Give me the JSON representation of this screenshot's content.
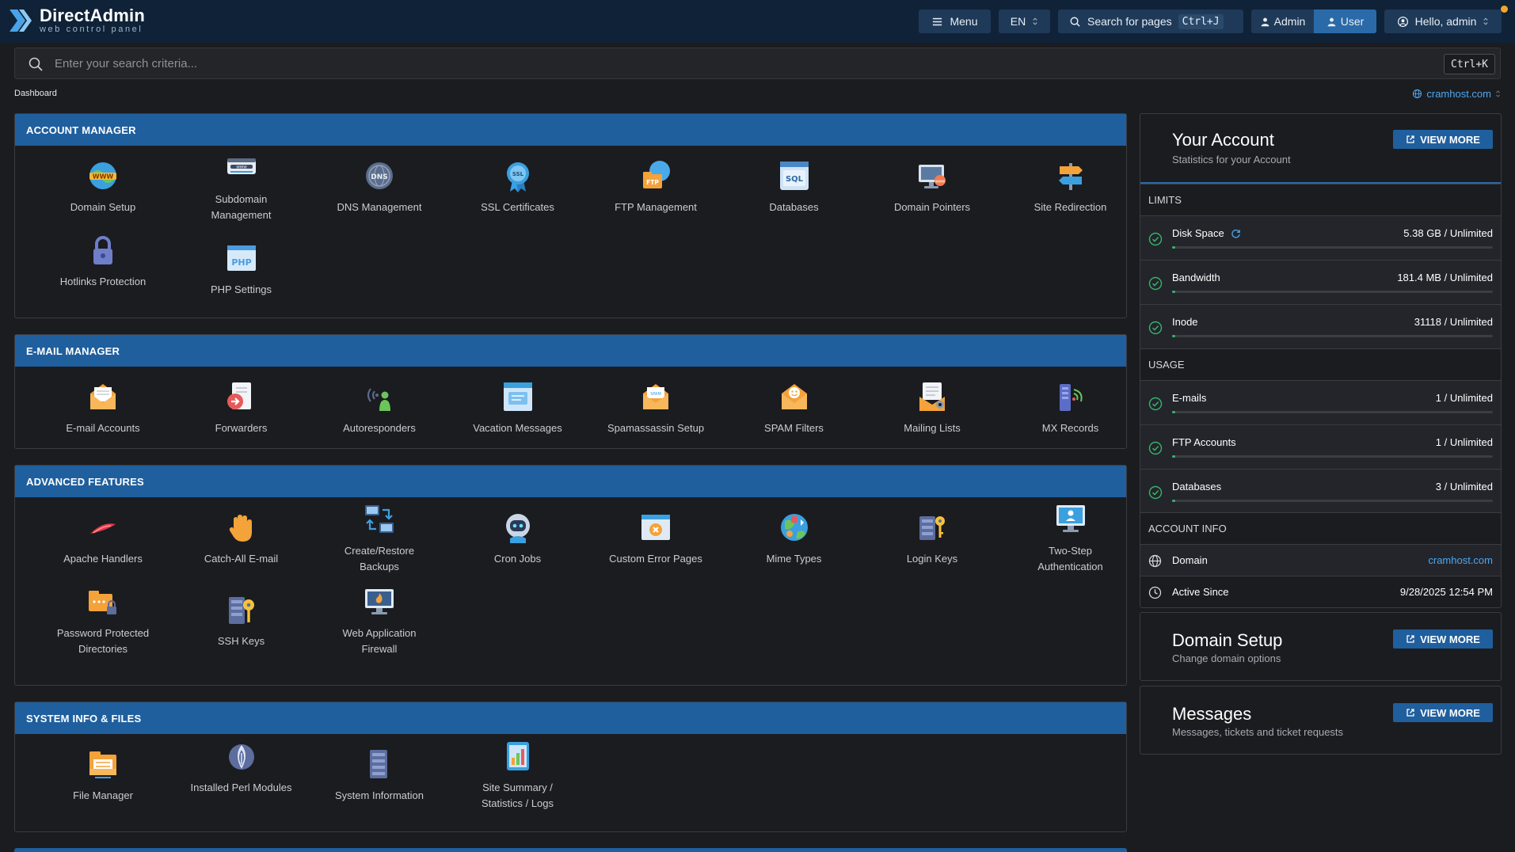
{
  "app": {
    "brand": "DirectAdmin",
    "brand_sub": "web control panel"
  },
  "topbar": {
    "menu_label": "Menu",
    "lang_label": "EN",
    "search_pages_label": "Search for pages",
    "search_pages_shortcut": "Ctrl+J",
    "role_admin": "Admin",
    "role_user": "User",
    "greeting": "Hello, admin"
  },
  "search": {
    "placeholder": "Enter your search criteria...",
    "shortcut": "Ctrl+K"
  },
  "breadcrumb": "Dashboard",
  "current_domain": "cramhost.com",
  "sections": {
    "account": {
      "title": "ACCOUNT MANAGER",
      "items": [
        {
          "label": "Domain Setup",
          "icon": "globe-www-icon"
        },
        {
          "label": "Subdomain Management",
          "icon": "subdomain-browser-icon"
        },
        {
          "label": "DNS Management",
          "icon": "dns-globe-icon"
        },
        {
          "label": "SSL Certificates",
          "icon": "ssl-badge-icon"
        },
        {
          "label": "FTP Management",
          "icon": "ftp-folder-icon"
        },
        {
          "label": "Databases",
          "icon": "sql-database-icon"
        },
        {
          "label": "Domain Pointers",
          "icon": "monitor-www-icon"
        },
        {
          "label": "Site Redirection",
          "icon": "signpost-icon"
        },
        {
          "label": "Hotlinks Protection",
          "icon": "padlock-icon"
        },
        {
          "label": "PHP Settings",
          "icon": "php-window-icon"
        }
      ]
    },
    "email": {
      "title": "E-MAIL MANAGER",
      "items": [
        {
          "label": "E-mail Accounts",
          "icon": "envelope-open-icon"
        },
        {
          "label": "Forwarders",
          "icon": "forward-document-icon"
        },
        {
          "label": "Autoresponders",
          "icon": "broadcast-person-icon"
        },
        {
          "label": "Vacation Messages",
          "icon": "calendar-message-icon"
        },
        {
          "label": "Spamassassin Setup",
          "icon": "envelope-spam-icon"
        },
        {
          "label": "SPAM Filters",
          "icon": "envelope-filter-icon"
        },
        {
          "label": "Mailing Lists",
          "icon": "envelope-list-icon"
        },
        {
          "label": "MX Records",
          "icon": "server-signal-icon"
        }
      ]
    },
    "advanced": {
      "title": "ADVANCED FEATURES",
      "items": [
        {
          "label": "Apache Handlers",
          "icon": "apache-feather-icon"
        },
        {
          "label": "Catch-All E-mail",
          "icon": "catching-hand-icon"
        },
        {
          "label": "Create/Restore Backups",
          "icon": "backup-computers-icon"
        },
        {
          "label": "Cron Jobs",
          "icon": "robot-icon"
        },
        {
          "label": "Custom Error Pages",
          "icon": "error-page-icon"
        },
        {
          "label": "Mime Types",
          "icon": "mime-globe-icon"
        },
        {
          "label": "Login Keys",
          "icon": "server-key-icon"
        },
        {
          "label": "Two-Step Authentication",
          "icon": "two-step-monitor-icon"
        },
        {
          "label": "Password Protected Directories",
          "icon": "locked-folder-icon"
        },
        {
          "label": "SSH Keys",
          "icon": "ssh-server-key-icon"
        },
        {
          "label": "Web Application Firewall",
          "icon": "firewall-monitor-icon"
        }
      ]
    },
    "system": {
      "title": "SYSTEM INFO & FILES",
      "items": [
        {
          "label": "File Manager",
          "icon": "folder-icon"
        },
        {
          "label": "Installed Perl Modules",
          "icon": "perl-onion-icon"
        },
        {
          "label": "System Information",
          "icon": "server-info-icon"
        },
        {
          "label": "Site Summary / Statistics / Logs",
          "icon": "statistics-device-icon"
        }
      ]
    }
  },
  "account_card": {
    "title": "Your Account",
    "subtitle": "Statistics for your Account",
    "view_more": "VIEW MORE",
    "limits_title": "LIMITS",
    "usage_title": "USAGE",
    "info_title": "ACCOUNT INFO",
    "limits": [
      {
        "name": "Disk Space",
        "value": "5.38 GB / Unlimited",
        "percent": 1
      },
      {
        "name": "Bandwidth",
        "value": "181.4 MB / Unlimited",
        "percent": 1
      },
      {
        "name": "Inode",
        "value": "31118 / Unlimited",
        "percent": 1
      }
    ],
    "usage": [
      {
        "name": "E-mails",
        "value": "1 / Unlimited",
        "percent": 1
      },
      {
        "name": "FTP Accounts",
        "value": "1 / Unlimited",
        "percent": 1
      },
      {
        "name": "Databases",
        "value": "3 / Unlimited",
        "percent": 1
      }
    ],
    "info": [
      {
        "name": "Domain",
        "value": "cramhost.com"
      },
      {
        "name": "Active Since",
        "value": "9/28/2025 12:54 PM"
      }
    ]
  },
  "domain_card": {
    "title": "Domain Setup",
    "subtitle": "Change domain options",
    "view_more": "VIEW MORE"
  },
  "messages_card": {
    "title": "Messages",
    "subtitle": "Messages, tickets and ticket requests",
    "view_more": "VIEW MORE"
  },
  "colors": {
    "topbar": "#0f2237",
    "section_header": "#1f5f9e",
    "accent_link": "#4ea6f0",
    "ok_green": "#37b36b"
  }
}
